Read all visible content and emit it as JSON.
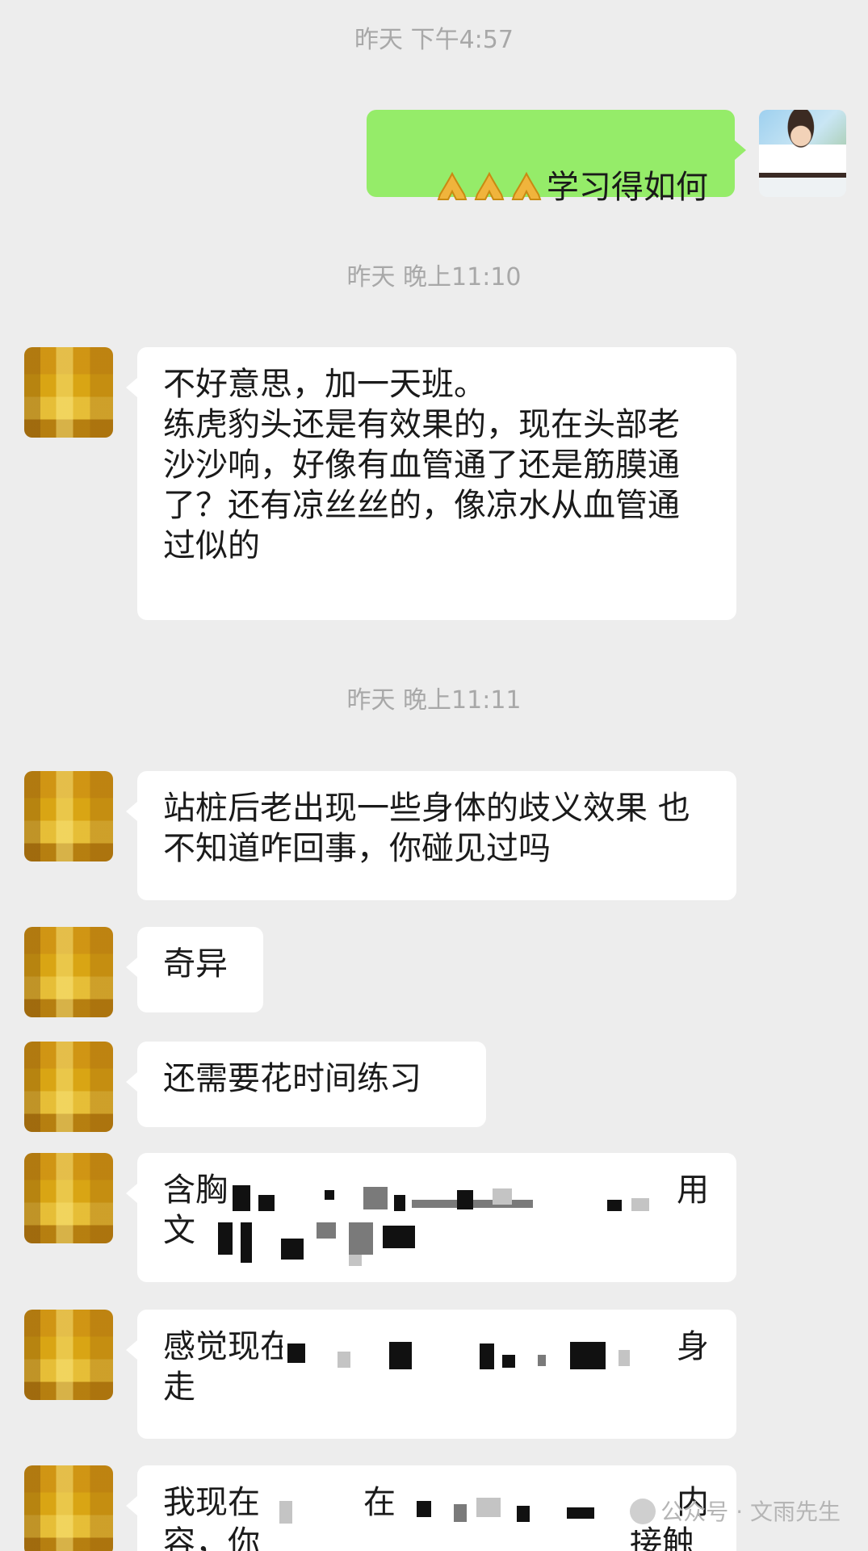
{
  "timestamps": [
    "昨天 下午4:57",
    "昨天 晚上11:10",
    "昨天 晚上11:11"
  ],
  "sent_message": {
    "emoji": "🙏🙏🙏",
    "text": "学习得如何"
  },
  "messages": [
    "不好意思，加一天班。\n练虎豹头还是有效果的，现在头部老沙沙响，好像有血管通了还是筋膜通了？还有凉丝丝的，像凉水从血管通过似的",
    "站桩后老出现一些身体的歧义效果 也不知道咋回事，你碰见过吗",
    "奇异",
    "还需要花时间练习",
    "含胸",
    "用",
    "文",
    "感觉现在",
    "身",
    "走",
    "我现在",
    "在",
    "内",
    "容，你",
    "接触"
  ],
  "watermark": "公众号 · 文雨先生",
  "colors": {
    "background": "#ededed",
    "sent_bubble": "#95ec69",
    "received_bubble": "#ffffff",
    "timestamp": "#a8a8a8"
  }
}
